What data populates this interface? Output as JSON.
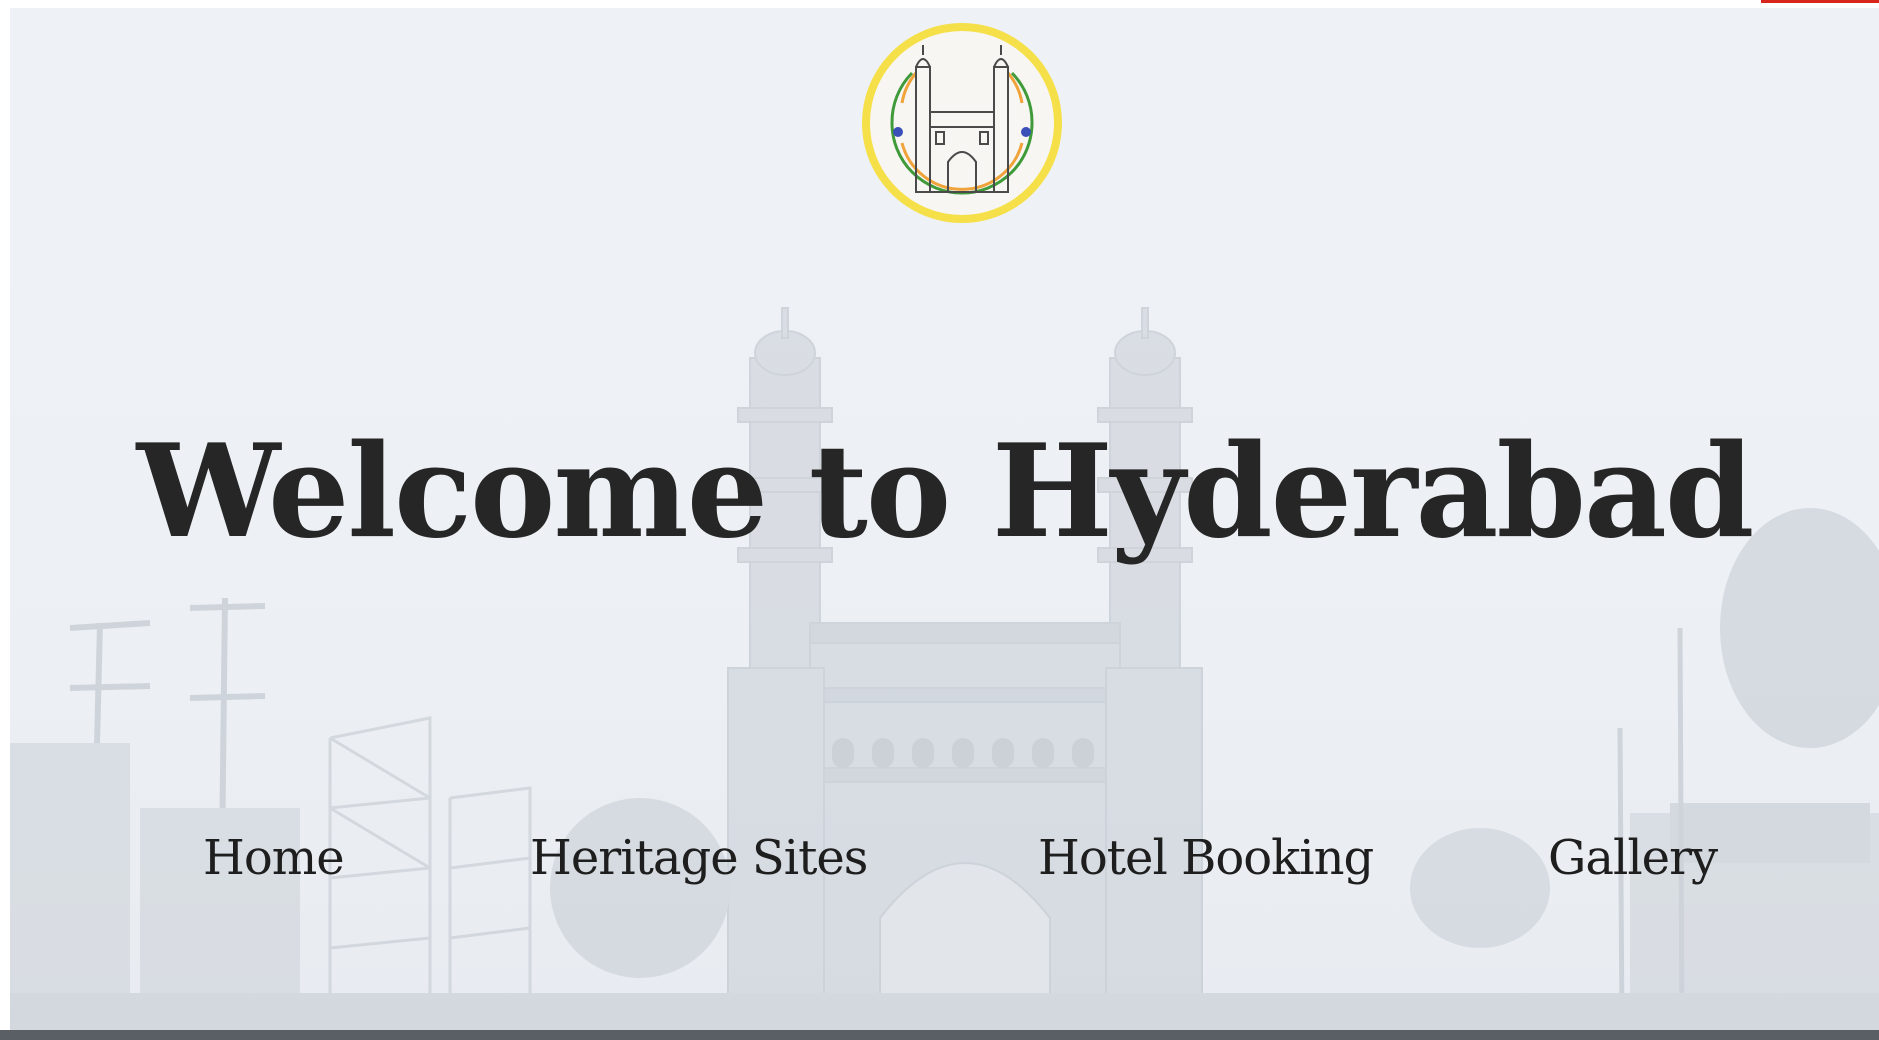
{
  "colors": {
    "title": "#262626",
    "nav_text": "#1e1e1e",
    "background": "#eef2f6",
    "logo_ring": "#f5e04a",
    "logo_orange": "#f0a33a",
    "logo_green": "#3f9a3a",
    "logo_chakra": "#3b4fb8",
    "top_accent": "#d9261c"
  },
  "logo": {
    "icon": "charminar-emblem-icon"
  },
  "hero": {
    "title": "Welcome to Hyderabad",
    "background_icon": "charminar-street-scene"
  },
  "nav": {
    "items": [
      {
        "label": "Home"
      },
      {
        "label": "Heritage Sites"
      },
      {
        "label": "Hotel Booking"
      },
      {
        "label": "Gallery"
      }
    ]
  }
}
